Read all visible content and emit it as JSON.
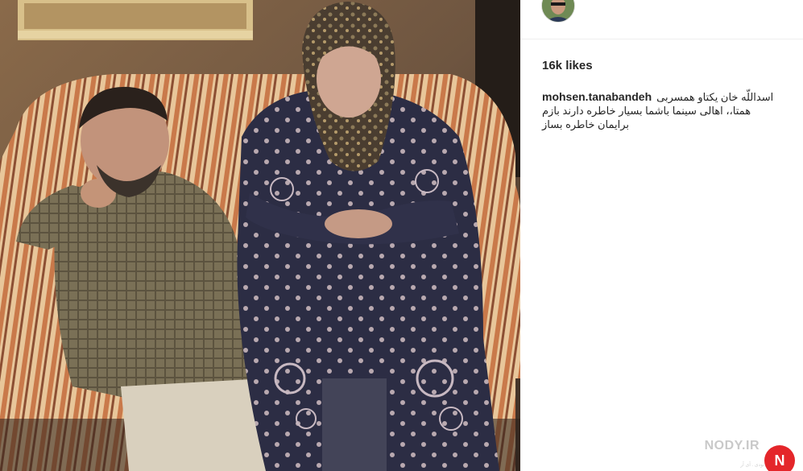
{
  "post": {
    "image_alt": "Two elderly people sitting on a striped sofa",
    "author": "mohsen.tanabandeh",
    "likes": "16k likes",
    "caption": "اسداللّه خان یکتاو همسربی همتا،، اهالی سینما باشما بسیار خاطره دارند بازم برایمان خاطره بساز"
  },
  "watermark": {
    "text": "NODY.IR",
    "sub": "نودی . آی آر",
    "badge": "N"
  },
  "colors": {
    "text": "#262626",
    "divider": "#efefef",
    "badge": "#e4262a"
  },
  "icons": {
    "avatar": "user-avatar"
  }
}
